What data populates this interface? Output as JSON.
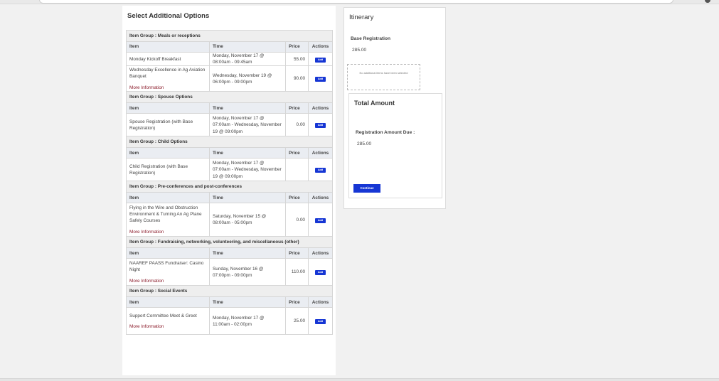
{
  "options": {
    "title": "Select Additional Options",
    "columns": {
      "item": "Item",
      "time": "Time",
      "price": "Price",
      "actions": "Actions"
    },
    "add_label": "Add",
    "more_info_label": "More Information",
    "groups": [
      {
        "label": "Item Group : Meals or receptions",
        "items": [
          {
            "name": "Monday Kickoff Breakfast",
            "time": "Monday, November 17 @ 08:00am - 09:45am",
            "price": "55.00",
            "more_info": false
          },
          {
            "name": "Wednesday Excellence in Ag Aviation Banquet",
            "time": "Wednesday, November 19 @ 06:00pm - 09:00pm",
            "price": "90.00",
            "more_info": true
          }
        ]
      },
      {
        "label": "Item Group : Spouse Options",
        "items": [
          {
            "name": "Spouse Registration (with Base Registration)",
            "time": "Monday, November 17 @ 07:00am - Wednesday, November 19 @ 09:00pm",
            "price": "0.00",
            "more_info": false
          }
        ]
      },
      {
        "label": "Item Group : Child Options",
        "items": [
          {
            "name": "Child Registration (with Base Registration)",
            "time": "Monday, November 17 @ 07:00am - Wednesday, November 19 @ 09:00pm",
            "price": "",
            "more_info": false
          }
        ]
      },
      {
        "label": "Item Group : Pre-conferences and post-conferences",
        "items": [
          {
            "name": "Flying in the Wire and Obstruction Environment & Turning An Ag Plane Safely Courses",
            "time": "Saturday, November 15 @ 08:00am - 05:00pm",
            "price": "0.00",
            "more_info": true
          }
        ]
      },
      {
        "label": "Item Group : Fundraising, networking, volunteering, and miscellaneous (other)",
        "items": [
          {
            "name": "NAAREF PAASS Fundraiser: Casino Night",
            "time": "Sunday, November 16 @ 07:00pm - 09:00pm",
            "price": "110.00",
            "more_info": true
          }
        ]
      },
      {
        "label": "Item Group : Social Events",
        "items": [
          {
            "name": "Support Committee Meet & Greet",
            "time": "Monday, November 17 @ 11:00am - 02:00pm",
            "price": "25.00",
            "more_info": true
          }
        ]
      }
    ]
  },
  "itinerary": {
    "title": "Itinerary",
    "base_label": "Base Registration",
    "base_price": "285.00",
    "no_items_text": "No additional items have been selected",
    "total_title": "Total Amount",
    "due_label": "Registration Amount Due :",
    "due_amount": "285.00",
    "continue_label": "Continue"
  },
  "colors": {
    "accent": "#1636d4",
    "link": "#8b1b2a"
  }
}
